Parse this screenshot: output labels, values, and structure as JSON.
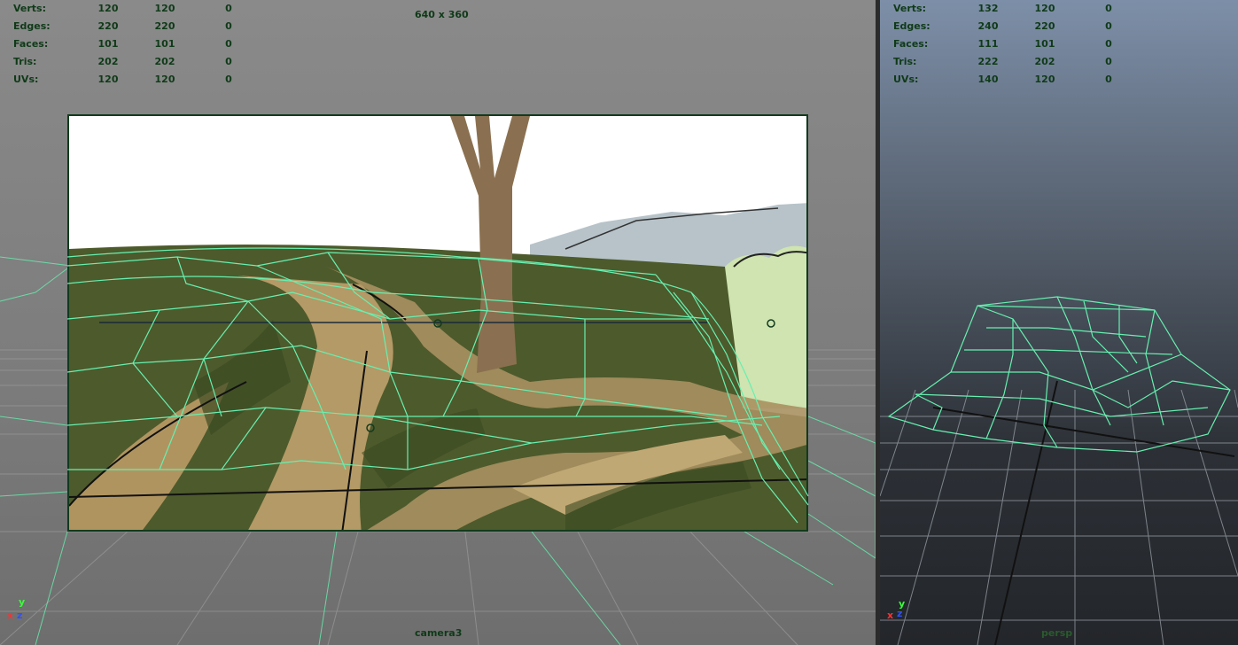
{
  "left_viewport": {
    "stats": [
      {
        "label": "Verts:",
        "v1": "120",
        "v2": "120",
        "v3": "0"
      },
      {
        "label": "Edges:",
        "v1": "220",
        "v2": "220",
        "v3": "0"
      },
      {
        "label": "Faces:",
        "v1": "101",
        "v2": "101",
        "v3": "0"
      },
      {
        "label": "Tris:",
        "v1": "202",
        "v2": "202",
        "v3": "0"
      },
      {
        "label": "UVs:",
        "v1": "120",
        "v2": "120",
        "v3": "0"
      }
    ],
    "resolution_gate": "640 x 360",
    "camera_name": "camera3"
  },
  "right_viewport": {
    "stats": [
      {
        "label": "Verts:",
        "v1": "132",
        "v2": "120",
        "v3": "0"
      },
      {
        "label": "Edges:",
        "v1": "240",
        "v2": "220",
        "v3": "0"
      },
      {
        "label": "Faces:",
        "v1": "111",
        "v2": "101",
        "v3": "0"
      },
      {
        "label": "Tris:",
        "v1": "222",
        "v2": "202",
        "v3": "0"
      },
      {
        "label": "UVs:",
        "v1": "140",
        "v2": "120",
        "v3": "0"
      }
    ],
    "camera_name": "persp"
  },
  "axis_gizmo": {
    "x": "x",
    "y": "y",
    "z": "z"
  },
  "colors": {
    "wireframe": "#66f0b0",
    "hud_text": "#0f3a18",
    "grass": "#4a5a2a",
    "path": "#b8a070",
    "trunk": "#8a7050"
  }
}
